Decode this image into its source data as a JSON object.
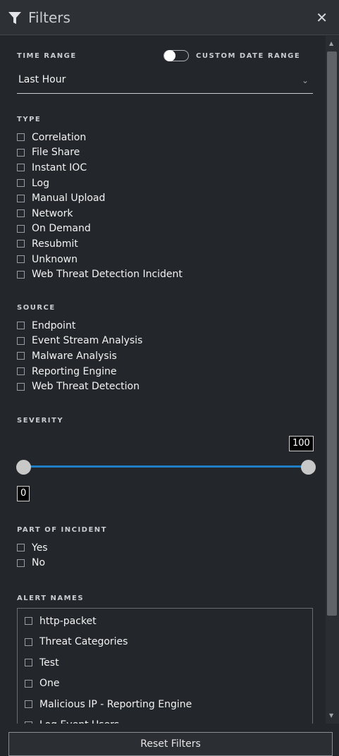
{
  "header": {
    "title": "Filters",
    "icons": [
      "funnel-icon",
      "close-icon"
    ]
  },
  "time_range": {
    "label": "TIME RANGE",
    "toggle_label": "CUSTOM DATE RANGE",
    "custom_date_range_on": false,
    "selected": "Last Hour"
  },
  "type": {
    "label": "TYPE",
    "items": [
      "Correlation",
      "File Share",
      "Instant IOC",
      "Log",
      "Manual Upload",
      "Network",
      "On Demand",
      "Resubmit",
      "Unknown",
      "Web Threat Detection Incident"
    ]
  },
  "source": {
    "label": "SOURCE",
    "items": [
      "Endpoint",
      "Event Stream Analysis",
      "Malware Analysis",
      "Reporting Engine",
      "Web Threat Detection"
    ]
  },
  "severity": {
    "label": "SEVERITY",
    "min": "0",
    "max": "100",
    "accent_color": "#1e7fc4"
  },
  "part_of_incident": {
    "label": "PART OF INCIDENT",
    "items": [
      "Yes",
      "No"
    ]
  },
  "alert_names": {
    "label": "ALERT NAMES",
    "items": [
      "http-packet",
      "Threat Categories",
      "Test",
      "One",
      "Malicious IP - Reporting Engine",
      "Log Event Users"
    ]
  },
  "footer": {
    "reset_label": "Reset Filters"
  }
}
